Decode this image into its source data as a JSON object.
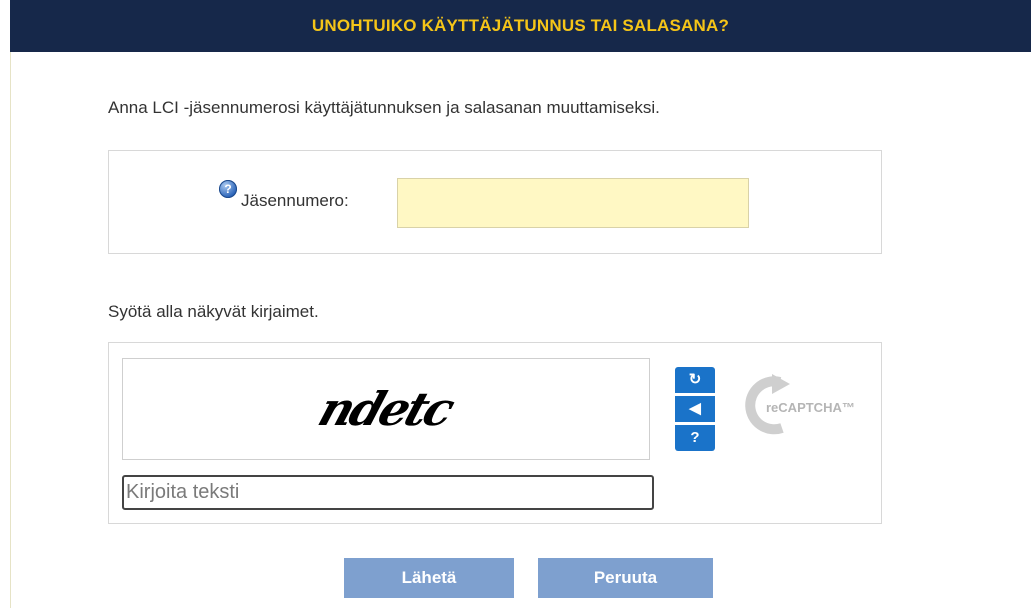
{
  "header": {
    "title": "UNOHTUIKO KÄYTTÄJÄTUNNUS TAI SALASANA?"
  },
  "intro": {
    "text": "Anna LCI -jäsennumerosi käyttäjätunnuksen ja salasanan muuttamiseksi."
  },
  "member": {
    "help_icon": "question-circle-icon",
    "label": "Jäsennumero:",
    "value": ""
  },
  "captcha": {
    "prompt": "Syötä alla näkyvät kirjaimet.",
    "challenge_text": "ndetc",
    "placeholder": "Kirjoita teksti",
    "buttons": {
      "reload": "↻",
      "audio": "◀",
      "help": "?"
    },
    "logo_text": "reCAPTCHA™"
  },
  "actions": {
    "send_label": "Lähetä",
    "cancel_label": "Peruuta"
  },
  "colors": {
    "header_bg": "#16284a",
    "header_text": "#f5c518",
    "input_bg": "#fff8c4",
    "button_bg": "#7ea0cf",
    "captcha_button_bg": "#1a73c9"
  }
}
